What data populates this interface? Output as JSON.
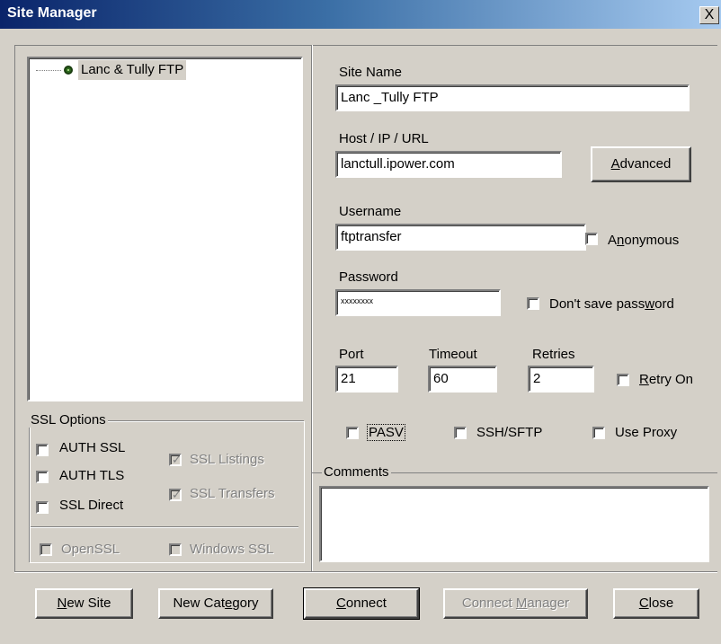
{
  "window": {
    "title": "Site Manager",
    "close_glyph": "X"
  },
  "tree": {
    "items": [
      {
        "label": "Lanc & Tully FTP",
        "icon": "site-connected-icon"
      }
    ]
  },
  "fields": {
    "site_name": {
      "label": "Site Name",
      "value": "Lanc _Tully FTP"
    },
    "host": {
      "label": "Host / IP / URL",
      "value": "lanctull.ipower.com"
    },
    "username": {
      "label": "Username",
      "value": "ftptransfer"
    },
    "password": {
      "label": "Password",
      "value": "xxxxxxxx"
    },
    "port": {
      "label": "Port",
      "value": "21"
    },
    "timeout": {
      "label": "Timeout",
      "value": "60"
    },
    "retries": {
      "label": "Retries",
      "value": "2"
    }
  },
  "buttons": {
    "advanced": {
      "pre": "",
      "u": "A",
      "post": "dvanced"
    },
    "new_site": {
      "pre": "",
      "u": "N",
      "post": "ew Site"
    },
    "new_category": {
      "pre": "New Cat",
      "u": "e",
      "post": "gory"
    },
    "connect": {
      "pre": "",
      "u": "C",
      "post": "onnect"
    },
    "connect_manager": {
      "pre": "Connect ",
      "u": "M",
      "post": "anager"
    },
    "close": {
      "pre": "",
      "u": "C",
      "post": "lose"
    }
  },
  "checkboxes": {
    "anonymous": {
      "pre": "A",
      "u": "n",
      "post": "onymous",
      "checked": false
    },
    "dont_save_password": {
      "pre": "Don't save pass",
      "u": "w",
      "post": "ord",
      "checked": false
    },
    "retry_on": {
      "pre": "",
      "u": "R",
      "post": "etry On",
      "checked": false
    },
    "pasv": {
      "label": "PASV",
      "checked": false
    },
    "ssh_sftp": {
      "label": "SSH/SFTP",
      "checked": false
    },
    "use_proxy": {
      "label": "Use Proxy",
      "checked": false
    }
  },
  "ssl": {
    "title": "SSL Options",
    "auth_ssl": {
      "label": "AUTH SSL",
      "checked": false
    },
    "auth_tls": {
      "label": "AUTH TLS",
      "checked": false
    },
    "ssl_direct": {
      "label": "SSL Direct",
      "checked": false
    },
    "ssl_listings": {
      "label": "SSL Listings",
      "checked": true,
      "disabled": true
    },
    "ssl_transfers": {
      "label": "SSL Transfers",
      "checked": true,
      "disabled": true
    },
    "openssl": {
      "label": "OpenSSL",
      "checked": false,
      "disabled": true
    },
    "windows_ssl": {
      "label": "Windows SSL",
      "checked": false,
      "disabled": true
    }
  },
  "comments": {
    "title": "Comments",
    "value": ""
  },
  "colors": {
    "face": "#d4d0c8",
    "title_start": "#0a246a",
    "title_end": "#a6caf0"
  }
}
